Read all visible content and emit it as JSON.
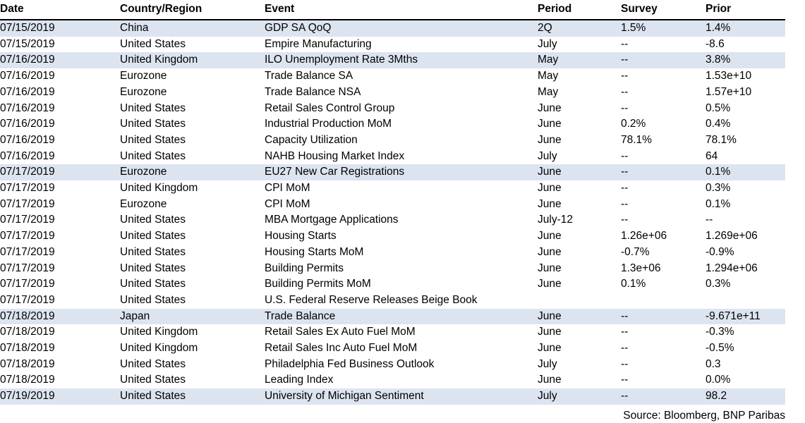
{
  "table": {
    "columns": [
      {
        "key": "date",
        "label": "Date"
      },
      {
        "key": "country",
        "label": "Country/Region"
      },
      {
        "key": "event",
        "label": "Event"
      },
      {
        "key": "period",
        "label": "Period"
      },
      {
        "key": "survey",
        "label": "Survey"
      },
      {
        "key": "prior",
        "label": "Prior"
      }
    ],
    "rows": [
      {
        "date": "07/15/2019",
        "country": "China",
        "event": "GDP SA QoQ",
        "period": "2Q",
        "survey": "1.5%",
        "prior": "1.4%",
        "shaded": true
      },
      {
        "date": "07/15/2019",
        "country": "United States",
        "event": "Empire Manufacturing",
        "period": "July",
        "survey": "--",
        "prior": "-8.6",
        "shaded": false
      },
      {
        "date": "07/16/2019",
        "country": "United Kingdom",
        "event": "ILO Unemployment Rate 3Mths",
        "period": "May",
        "survey": "--",
        "prior": "3.8%",
        "shaded": true
      },
      {
        "date": "07/16/2019",
        "country": "Eurozone",
        "event": "Trade Balance SA",
        "period": "May",
        "survey": "--",
        "prior": "1.53e+10",
        "shaded": false
      },
      {
        "date": "07/16/2019",
        "country": "Eurozone",
        "event": "Trade Balance NSA",
        "period": "May",
        "survey": "--",
        "prior": "1.57e+10",
        "shaded": false
      },
      {
        "date": "07/16/2019",
        "country": "United States",
        "event": "Retail Sales Control Group",
        "period": "June",
        "survey": "--",
        "prior": "0.5%",
        "shaded": false
      },
      {
        "date": "07/16/2019",
        "country": "United States",
        "event": "Industrial Production MoM",
        "period": "June",
        "survey": "0.2%",
        "prior": "0.4%",
        "shaded": false
      },
      {
        "date": "07/16/2019",
        "country": "United States",
        "event": "Capacity Utilization",
        "period": "June",
        "survey": "78.1%",
        "prior": "78.1%",
        "shaded": false
      },
      {
        "date": "07/16/2019",
        "country": "United States",
        "event": "NAHB Housing Market Index",
        "period": "July",
        "survey": "--",
        "prior": "64",
        "shaded": false
      },
      {
        "date": "07/17/2019",
        "country": "Eurozone",
        "event": "EU27 New Car Registrations",
        "period": "June",
        "survey": "--",
        "prior": "0.1%",
        "shaded": true
      },
      {
        "date": "07/17/2019",
        "country": "United Kingdom",
        "event": "CPI MoM",
        "period": "June",
        "survey": "--",
        "prior": "0.3%",
        "shaded": false
      },
      {
        "date": "07/17/2019",
        "country": "Eurozone",
        "event": "CPI MoM",
        "period": "June",
        "survey": "--",
        "prior": "0.1%",
        "shaded": false
      },
      {
        "date": "07/17/2019",
        "country": "United States",
        "event": "MBA Mortgage Applications",
        "period": "July-12",
        "survey": "--",
        "prior": "--",
        "shaded": false
      },
      {
        "date": "07/17/2019",
        "country": "United States",
        "event": "Housing Starts",
        "period": "June",
        "survey": "1.26e+06",
        "prior": "1.269e+06",
        "shaded": false
      },
      {
        "date": "07/17/2019",
        "country": "United States",
        "event": "Housing Starts MoM",
        "period": "June",
        "survey": "-0.7%",
        "prior": "-0.9%",
        "shaded": false
      },
      {
        "date": "07/17/2019",
        "country": "United States",
        "event": "Building Permits",
        "period": "June",
        "survey": "1.3e+06",
        "prior": "1.294e+06",
        "shaded": false
      },
      {
        "date": "07/17/2019",
        "country": "United States",
        "event": "Building Permits MoM",
        "period": "June",
        "survey": "0.1%",
        "prior": "0.3%",
        "shaded": false
      },
      {
        "date": "07/17/2019",
        "country": "United States",
        "event": "U.S. Federal Reserve Releases Beige Book",
        "period": "",
        "survey": "",
        "prior": "",
        "shaded": false
      },
      {
        "date": "07/18/2019",
        "country": "Japan",
        "event": "Trade Balance",
        "period": "June",
        "survey": "--",
        "prior": "-9.671e+11",
        "shaded": true
      },
      {
        "date": "07/18/2019",
        "country": "United Kingdom",
        "event": "Retail Sales Ex Auto Fuel MoM",
        "period": "June",
        "survey": "--",
        "prior": "-0.3%",
        "shaded": false
      },
      {
        "date": "07/18/2019",
        "country": "United Kingdom",
        "event": "Retail Sales Inc Auto Fuel MoM",
        "period": "June",
        "survey": "--",
        "prior": "-0.5%",
        "shaded": false
      },
      {
        "date": "07/18/2019",
        "country": "United States",
        "event": "Philadelphia Fed Business Outlook",
        "period": "July",
        "survey": "--",
        "prior": "0.3",
        "shaded": false
      },
      {
        "date": "07/18/2019",
        "country": "United States",
        "event": "Leading Index",
        "period": "June",
        "survey": "--",
        "prior": "0.0%",
        "shaded": false
      },
      {
        "date": "07/19/2019",
        "country": "United States",
        "event": "University of Michigan Sentiment",
        "period": "July",
        "survey": "--",
        "prior": "98.2",
        "shaded": true
      }
    ]
  },
  "footer": {
    "source": "Source: Bloomberg, BNP Paribas"
  },
  "colors": {
    "row_shading": "#dce4f0",
    "header_rule": "#000000",
    "text": "#000000"
  }
}
